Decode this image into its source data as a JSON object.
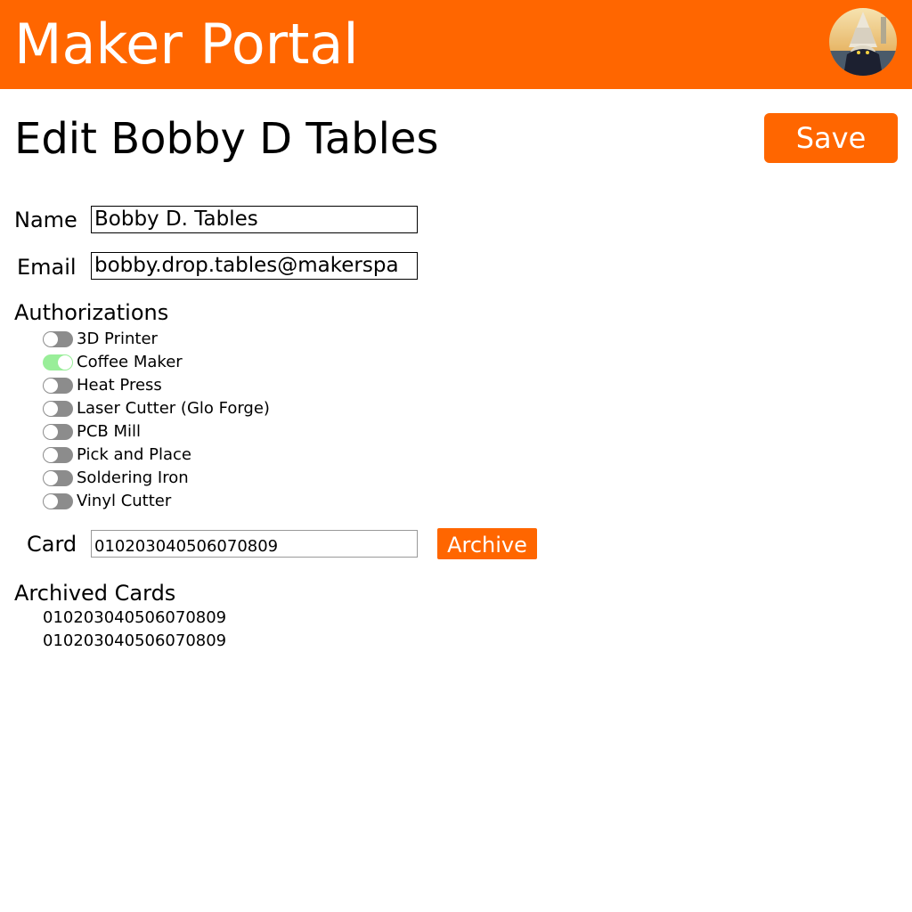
{
  "header": {
    "title": "Maker Portal",
    "avatar_icon": "user-avatar",
    "accent_color": "#ff6600"
  },
  "page": {
    "title": "Edit Bobby D Tables",
    "save_label": "Save"
  },
  "form": {
    "name_label": "Name",
    "name_value": "Bobby D. Tables",
    "email_label": "Email",
    "email_value": "bobby.drop.tables@makerspa"
  },
  "authorizations": {
    "title": "Authorizations",
    "items": [
      {
        "label": "3D Printer",
        "enabled": false
      },
      {
        "label": "Coffee Maker",
        "enabled": true
      },
      {
        "label": "Heat Press",
        "enabled": false
      },
      {
        "label": "Laser Cutter (Glo Forge)",
        "enabled": false
      },
      {
        "label": "PCB Mill",
        "enabled": false
      },
      {
        "label": "Pick and Place",
        "enabled": false
      },
      {
        "label": "Soldering Iron",
        "enabled": false
      },
      {
        "label": "Vinyl Cutter",
        "enabled": false
      }
    ]
  },
  "card": {
    "label": "Card",
    "value": "010203040506070809",
    "archive_label": "Archive"
  },
  "archived_cards": {
    "title": "Archived Cards",
    "items": [
      "010203040506070809",
      "010203040506070809"
    ]
  },
  "colors": {
    "toggle_on": "#99ee99",
    "toggle_off": "#8c8c8c"
  }
}
